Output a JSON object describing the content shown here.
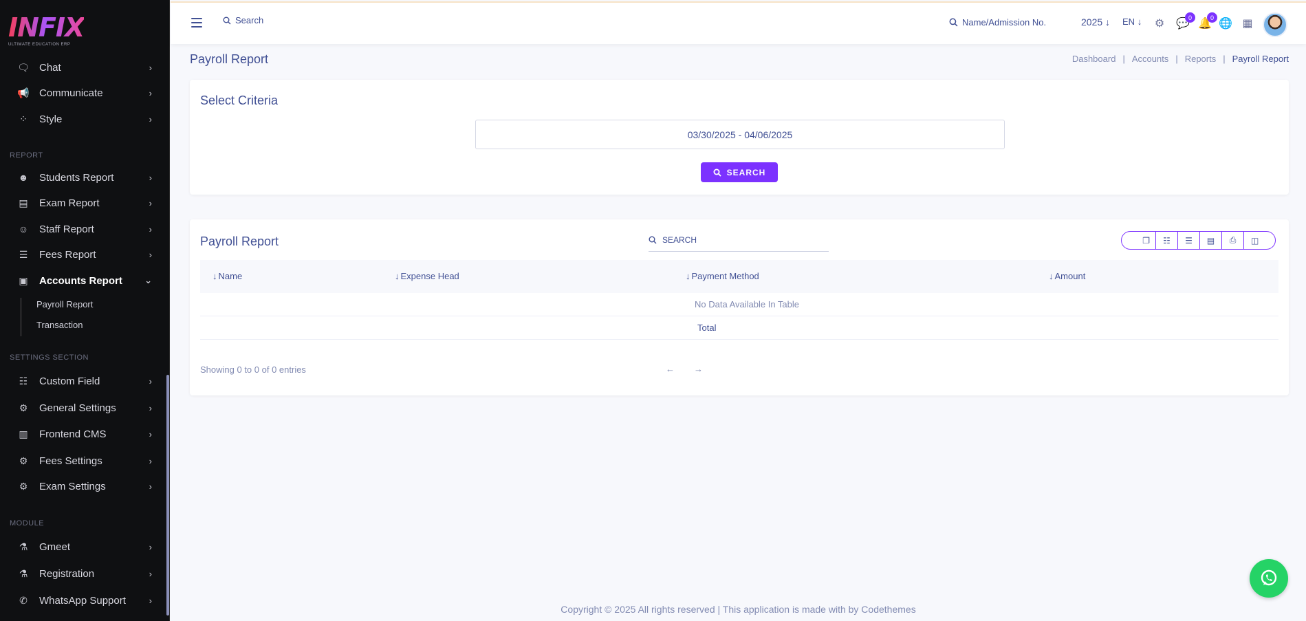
{
  "brand": {
    "name": "INFIX",
    "tagline": "ULTIMATE EDUCATION ERP"
  },
  "sidebar": {
    "top_items": [
      {
        "label": "Chat",
        "icon": "chat-icon"
      },
      {
        "label": "Communicate",
        "icon": "megaphone-icon"
      },
      {
        "label": "Style",
        "icon": "style-icon"
      }
    ],
    "report_section": "REPORT",
    "report_items": [
      {
        "label": "Students Report",
        "icon": "users-icon"
      },
      {
        "label": "Exam Report",
        "icon": "book-icon"
      },
      {
        "label": "Staff Report",
        "icon": "user-tie-icon"
      },
      {
        "label": "Fees Report",
        "icon": "list-icon"
      },
      {
        "label": "Accounts Report",
        "icon": "money-icon"
      }
    ],
    "accounts_sub": [
      "Payroll Report",
      "Transaction"
    ],
    "settings_section": "SETTINGS SECTION",
    "settings_items": [
      {
        "label": "Custom Field",
        "icon": "field-icon"
      },
      {
        "label": "General Settings",
        "icon": "gears-icon"
      },
      {
        "label": "Frontend CMS",
        "icon": "cms-icon"
      },
      {
        "label": "Fees Settings",
        "icon": "gears-icon"
      },
      {
        "label": "Exam Settings",
        "icon": "gears-icon"
      }
    ],
    "module_section": "MODULE",
    "module_items": [
      {
        "label": "Gmeet",
        "icon": "flask-icon"
      },
      {
        "label": "Registration",
        "icon": "flask-icon"
      },
      {
        "label": "WhatsApp Support",
        "icon": "whatsapp-icon"
      }
    ]
  },
  "topbar": {
    "search_label": "Search",
    "name_search": "Name/Admission No.",
    "year": "2025",
    "lang": "EN",
    "chat_badge": "0",
    "notif_badge": "0"
  },
  "page": {
    "title": "Payroll Report",
    "breadcrumb": [
      "Dashboard",
      "Accounts",
      "Reports",
      "Payroll Report"
    ]
  },
  "criteria": {
    "title": "Select Criteria",
    "date_range": "03/30/2025 - 04/06/2025",
    "search_button": "SEARCH"
  },
  "table": {
    "title": "Payroll Report",
    "search_placeholder": "SEARCH",
    "columns": [
      "Name",
      "Expense Head",
      "Payment Method",
      "Amount"
    ],
    "empty_message": "No Data Available In Table",
    "total_label": "Total",
    "info": "Showing 0 to 0 of 0 entries"
  },
  "footer": {
    "copyright": "Copyright © 2025 All rights reserved | This application is made with by Codethemes"
  },
  "colors": {
    "accent": "#7c32ff",
    "text": "#415094",
    "sidebar_bg": "#0f1012",
    "whatsapp": "#25d366"
  }
}
